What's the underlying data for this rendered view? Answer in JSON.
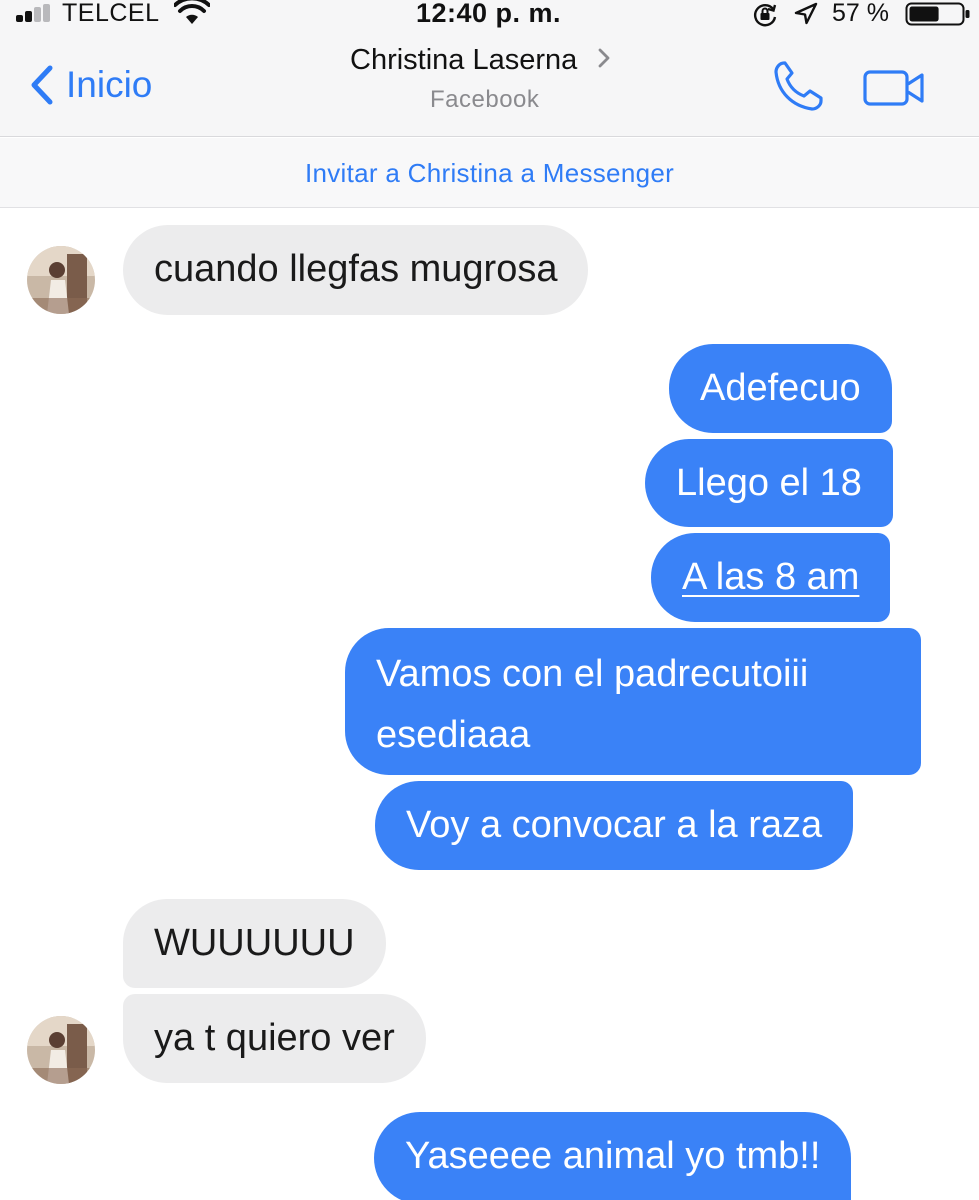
{
  "status_bar": {
    "carrier": "TELCEL",
    "time": "12:40 p. m.",
    "battery_percent": "57 %",
    "battery_level": 0.57,
    "signal_bars": 2
  },
  "nav": {
    "back_label": "Inicio",
    "contact_name": "Christina Laserna",
    "contact_source": "Facebook"
  },
  "invite": {
    "text": "Invitar a Christina a Messenger"
  },
  "colors": {
    "accent": "#2f7cf6",
    "outgoing_bubble": "#3a82f7",
    "incoming_bubble": "#ececed"
  },
  "messages": [
    {
      "sender": "contact",
      "text": "cuando llegfas mugrosa"
    },
    {
      "sender": "me",
      "text": "Adefecuo"
    },
    {
      "sender": "me",
      "text": "Llego el 18"
    },
    {
      "sender": "me",
      "text": "A las 8 am"
    },
    {
      "sender": "me",
      "text": "Vamos con el padrecutoiii esediaaa"
    },
    {
      "sender": "me",
      "text": "Voy a convocar a la raza"
    },
    {
      "sender": "contact",
      "text": "WUUUUUU"
    },
    {
      "sender": "contact",
      "text": "ya t quiero ver"
    },
    {
      "sender": "me",
      "text": "Yaseeee animal yo tmb!!"
    }
  ]
}
